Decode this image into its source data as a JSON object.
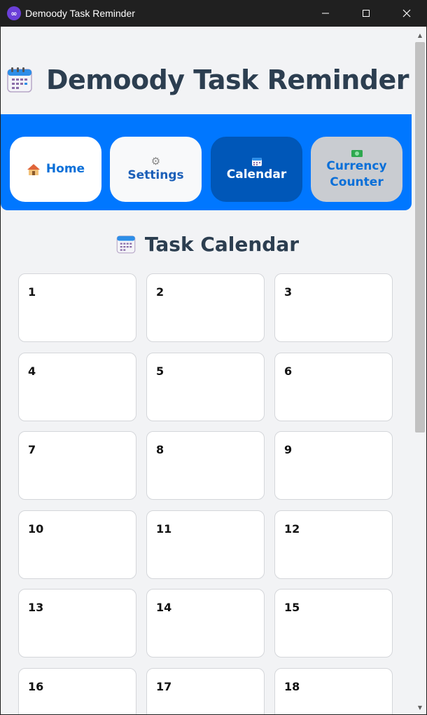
{
  "window": {
    "title": "Demoody Task Reminder",
    "icon": "app-logo-icon",
    "controls": {
      "minimize": "─",
      "maximize": "☐",
      "close": "✕"
    }
  },
  "header": {
    "title": "Demoody Task Reminder",
    "icon": "calendar-icon"
  },
  "nav": {
    "home": {
      "label": "Home",
      "icon": "house-icon"
    },
    "settings": {
      "label": "Settings",
      "icon": "gear-icon"
    },
    "calendar": {
      "label": "Calendar",
      "icon": "calendar-icon",
      "active": true
    },
    "currency": {
      "label_line1": "Currency",
      "label_line2": "Counter",
      "icon": "money-icon"
    }
  },
  "calendar": {
    "title": "Task Calendar",
    "days": [
      "1",
      "2",
      "3",
      "4",
      "5",
      "6",
      "7",
      "8",
      "9",
      "10",
      "11",
      "12",
      "13",
      "14",
      "15",
      "16",
      "17",
      "18"
    ]
  },
  "colors": {
    "nav_bar": "#0077ff",
    "active_tab": "#0057b8",
    "heading": "#2c3e50",
    "background": "#f2f3f5"
  }
}
